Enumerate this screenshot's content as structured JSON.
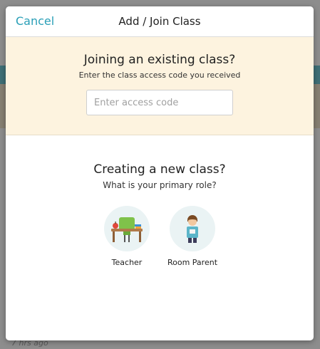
{
  "background": {
    "timestamp": "7 hrs ago"
  },
  "header": {
    "cancel_label": "Cancel",
    "title": "Add / Join Class"
  },
  "join": {
    "heading": "Joining an existing class?",
    "subtitle": "Enter the class access code you received",
    "input_placeholder": "Enter access code",
    "input_value": ""
  },
  "create": {
    "heading": "Creating a new class?",
    "subtitle": "What is your primary role?",
    "roles": [
      {
        "label": "Teacher",
        "icon": "teacher-desk-icon"
      },
      {
        "label": "Room Parent",
        "icon": "room-parent-icon"
      }
    ]
  },
  "colors": {
    "accent": "#2a9fb7",
    "join_background": "#fdf3df",
    "role_circle": "#eaf3f4"
  }
}
